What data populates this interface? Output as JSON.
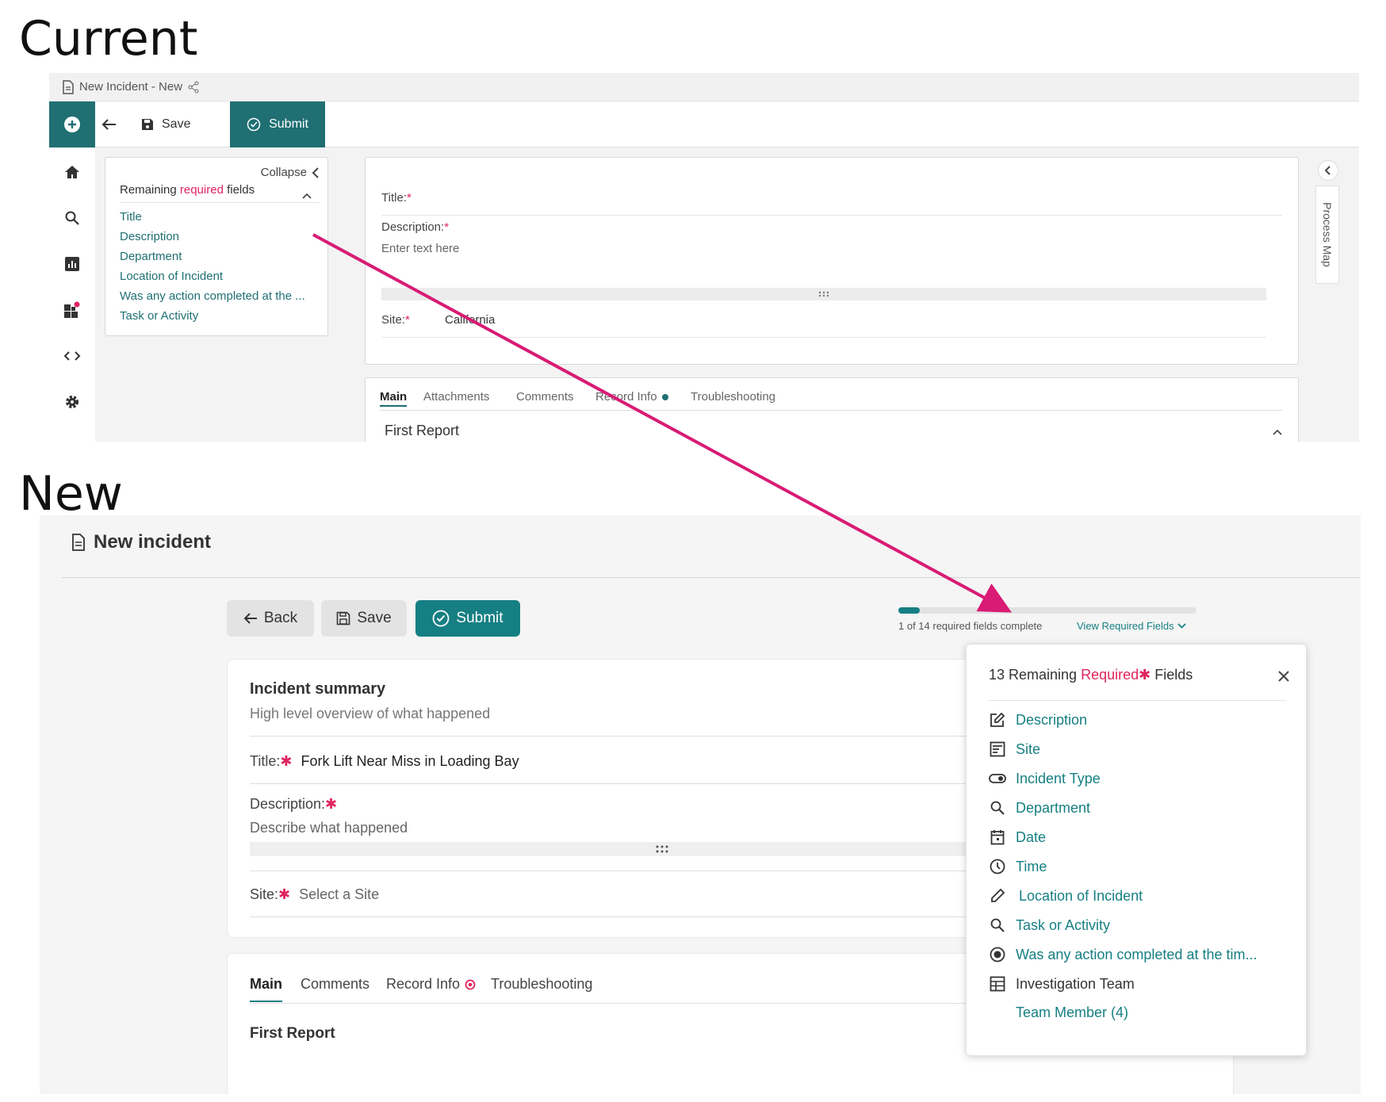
{
  "labels": {
    "current": "Current",
    "new": "New"
  },
  "current": {
    "doc_tab": "New Incident - New",
    "toolbar": {
      "save": "Save",
      "submit": "Submit"
    },
    "req_panel": {
      "collapse": "Collapse",
      "title_pre": "Remaining ",
      "title_req": "required",
      "title_post": " fields",
      "items": [
        "Title",
        "Description",
        "Department",
        "Location of Incident",
        "Was any action completed at the ...",
        "Task or Activity"
      ]
    },
    "form": {
      "title_label": "Title:",
      "desc_label": "Description:",
      "desc_placeholder": "Enter text here",
      "site_label": "Site:",
      "site_value": "California",
      "star": "*"
    },
    "process_map": "Process Map",
    "tabs": [
      "Main",
      "Attachments",
      "Comments",
      "Record Info",
      "Troubleshooting"
    ],
    "section": "First Report"
  },
  "new": {
    "header": "New incident",
    "buttons": {
      "back": "Back",
      "save": "Save",
      "submit": "Submit"
    },
    "progress": {
      "text": "1 of 14 required fields complete",
      "link": "View Required Fields",
      "completed": 1,
      "total": 14
    },
    "summary": {
      "title": "Incident summary",
      "subtitle": "High level overview of what happened",
      "title_label": "Title:",
      "title_value": "Fork Lift Near Miss in Loading Bay",
      "desc_label": "Description:",
      "desc_placeholder": "Describe what happened",
      "site_label": "Site:",
      "site_placeholder": "Select a Site",
      "star": "✱"
    },
    "tabs": [
      "Main",
      "Comments",
      "Record Info",
      "Troubleshooting"
    ],
    "section": "First Report",
    "popup": {
      "title_pre": "13 Remaining ",
      "title_req": "Required",
      "title_star": "✱",
      "title_post": " Fields",
      "items": [
        {
          "label": "Description",
          "icon": "edit-icon"
        },
        {
          "label": "Site",
          "icon": "form-icon"
        },
        {
          "label": "Incident Type",
          "icon": "toggle-icon"
        },
        {
          "label": "Department",
          "icon": "search-icon"
        },
        {
          "label": "Date",
          "icon": "calendar-icon"
        },
        {
          "label": "Time",
          "icon": "clock-icon"
        },
        {
          "label": "Location of Incident",
          "icon": "pencil-icon"
        },
        {
          "label": "Task or Activity",
          "icon": "search-icon"
        },
        {
          "label": "Was any action completed at the tim...",
          "icon": "radio-icon"
        },
        {
          "label": "Investigation Team",
          "icon": "table-icon"
        },
        {
          "label": "Team Member (4)",
          "icon": ""
        }
      ]
    }
  },
  "colors": {
    "teal": "#167f83",
    "teal_dark": "#1f6f73",
    "required_red": "#e0245e",
    "arrow": "#d81b75"
  }
}
